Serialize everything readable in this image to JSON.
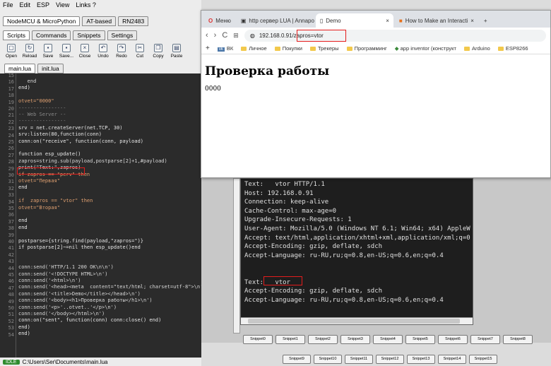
{
  "ide": {
    "menu": [
      "File",
      "Edit",
      "ESP",
      "View",
      "Links ?"
    ],
    "top_tabs": [
      "NodeMCU & MicroPython",
      "AT-based",
      "RN2483"
    ],
    "sub_tabs": [
      "Scripts",
      "Commands",
      "Snippets",
      "Settings"
    ],
    "toolbar": [
      "Open",
      "Reload",
      "Save",
      "Save...",
      "Close",
      "Undo",
      "Redo",
      "Cut",
      "Copy",
      "Paste"
    ],
    "file_tabs": [
      "main.lua",
      "init.lua"
    ],
    "line_numbers": [
      "15",
      "16",
      "17",
      "18",
      "19",
      "20",
      "21",
      "22",
      "23",
      "24",
      "25",
      "26",
      "27",
      "28",
      "29",
      "30",
      "31",
      "32",
      "33",
      "34",
      "35",
      "36",
      "37",
      "38",
      "39",
      "40",
      "41",
      "42",
      "43",
      "44",
      "45",
      "46",
      "47",
      "48",
      "49",
      "50",
      "51",
      "52",
      "53",
      "54"
    ],
    "code": [
      "   end",
      "end)",
      "",
      "otvet=\"0000\"",
      "----------------",
      "-- Web Server --",
      "----------------",
      "srv = net.createServer(net.TCP, 30)",
      "srv:listen(80,function(conn)",
      "conn:on(\"receive\", function(conn, payload)",
      "",
      "function esp_update()",
      "zapros=string.sub(payload,postparse[2]+1,#payload)",
      "print(\"Text:\",zapros)",
      "if zapros == \"perv\" then",
      "otvet=\"Первая\"",
      "end",
      "",
      "if  zapros == \"vtor\" then",
      "otvet=\"Вторая\"",
      "",
      "end",
      "end",
      "",
      "postparse={string.find(payload,\"zapros=\")}",
      "if postparse[2]~=nil then esp_update()end",
      "",
      "",
      "conn:send('HTTP/1.1 200 OK\\n\\n')",
      "conn:send('<!DOCTYPE HTML>\\n')",
      "conn:send('<html>\\n')",
      "conn:send('<head><meta  content=\"text/html; charset=utf-8\">\\n')",
      "conn:send('<title>Demo</title></head>\\n')",
      "conn:send('<body><h1>Проверка работы</h1>\\n')",
      "conn:send('<p>'..otvet..'</p>\\n')",
      "conn:send('</body></html>\\n')",
      "conn:on(\"sent\", function(conn) conn:close() end)",
      "end)",
      "end)",
      ""
    ],
    "status_label": "IDLE",
    "status_path": "C:\\Users\\Ser\\Documents\\main.lua"
  },
  "browser": {
    "tabs": [
      "Меню",
      "http сервер LUA | Annapo",
      "Demo",
      "How to Make an Interacti"
    ],
    "url": "192.168.0.91/zapros=vtor",
    "bookmarks": [
      "ВК",
      "Личное",
      "Покупки",
      "Трекеры",
      "Программинг",
      "app inventor (конструкт",
      "Arduino",
      "ESP8266"
    ],
    "heading": "Проверка работы",
    "body": "0000"
  },
  "terminal": {
    "lines": [
      "Text:   vtor HTTP/1.1",
      "Host: 192.168.0.91",
      "Connection: keep-alive",
      "Cache-Control: max-age=0",
      "Upgrade-Insecure-Requests: 1",
      "User-Agent: Mozilla/5.0 (Windows NT 6.1; Win64; x64) AppleW",
      "Accept: text/html,application/xhtml+xml,application/xml;q=0",
      "Accept-Encoding: gzip, deflate, sdch",
      "Accept-Language: ru-RU,ru;q=0.8,en-US;q=0.6,en;q=0.4",
      "",
      "",
      "Text:   vtor",
      "Accept-Encoding: gzip, deflate, sdch",
      "Accept-Language: ru-RU,ru;q=0.8,en-US;q=0.6,en;q=0.4"
    ]
  },
  "snippets_row1": [
    "Snippet0",
    "Snippet1",
    "Snippet2",
    "Snippet3",
    "Snippet4",
    "Snippet5",
    "Snippet6",
    "Snippet7",
    "Snippet8"
  ],
  "snippets_row2": [
    "Snippet9",
    "Snippet10",
    "Snippet11",
    "Snippet12",
    "Snippet13",
    "Snippet14",
    "Snippet15"
  ],
  "colors": {
    "highlight": "#e41c1c",
    "editor_bg": "#2b2b2b",
    "idle": "#2e8b2e"
  }
}
